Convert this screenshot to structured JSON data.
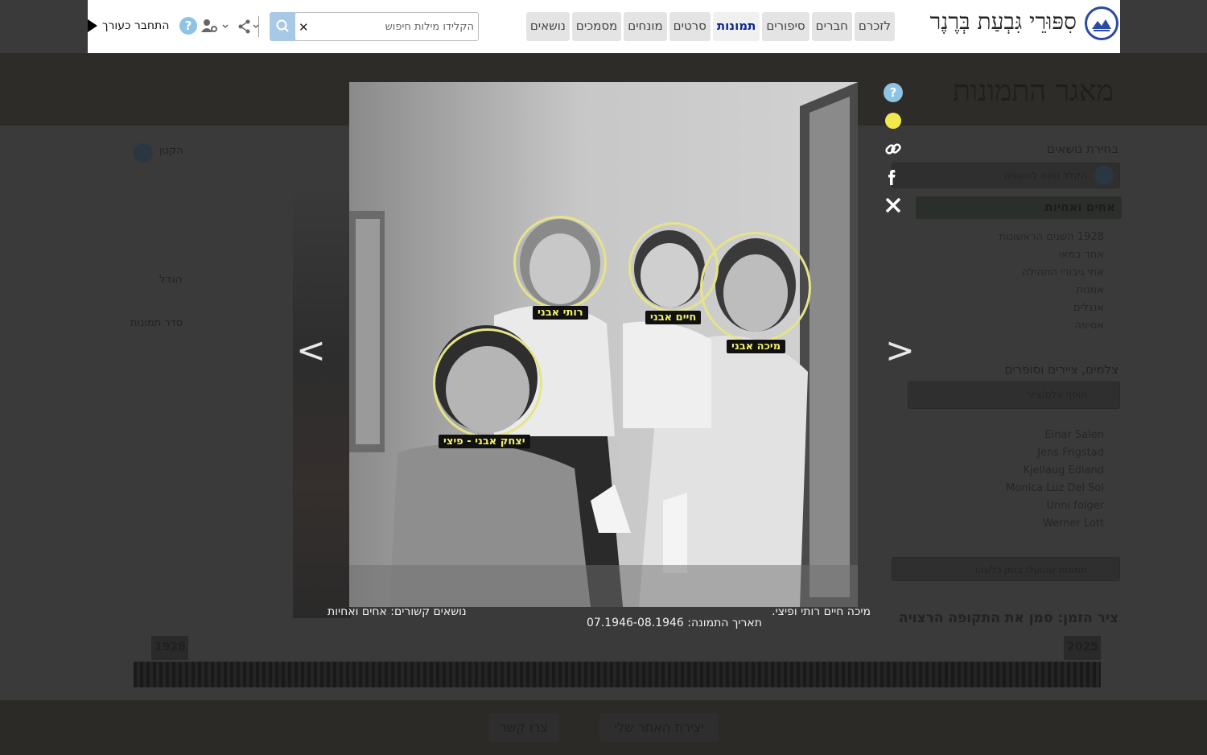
{
  "header": {
    "site_title": "סִפּוּרֵי גִּבְעַת בְּרֶנֶר",
    "nav": [
      {
        "label": "לזכרם",
        "active": false
      },
      {
        "label": "חברים",
        "active": false
      },
      {
        "label": "סיפורים",
        "active": false
      },
      {
        "label": "תמונות",
        "active": true
      },
      {
        "label": "סרטים",
        "active": false
      },
      {
        "label": "מונחים",
        "active": false
      },
      {
        "label": "מסמכים",
        "active": false
      },
      {
        "label": "נושאים",
        "active": false
      }
    ],
    "search_placeholder": "הקלידו מילות חיפוש",
    "clear_icon": "close-icon",
    "search_icon": "search-icon",
    "help_icon": "help-icon",
    "user_admin_icon": "user-gear-icon",
    "share_icon": "share-icon",
    "login_label": "התחבר כעורך",
    "colors": {
      "active_tab": "#0b2a8a",
      "search_button": "#a7c9e6",
      "logo": "#2c4aa0"
    }
  },
  "background_page": {
    "title": "מאגר התמונות",
    "topics_label": "בחירת נושאים",
    "topics_placeholder": "הקלד נושא להוספה",
    "selected_topic": "אחים ואחיות",
    "topics": [
      "1928 השנים הראשונות",
      "אחד במאי",
      "אחי גיבורי התהילה",
      "אמנות",
      "אנגלים",
      "אסיפה",
      "..."
    ],
    "photographers_label": "צלמים, ציירים וסופרים",
    "photographers_placeholder": "הוסף צלם/צייר",
    "photographers": [
      "Einar Salen",
      "Jens Frigstad",
      "Kjellaug Edland",
      "Monica Luz Del Sol",
      "Unni folger",
      "Werner Lott",
      "..."
    ],
    "uploaded_select": "תמונות שהועלו בזמן כלשהו",
    "timeline_label": "ציר הזמן: סמן את התקופה הרצויה",
    "year_start": "1928",
    "year_end": "2025",
    "zoom_out_label": "הקטן",
    "zoom_in_label": "הגדל",
    "photo_count_label": "סדר תמונות",
    "footer_contact": "צרו קשר",
    "footer_create": "יצירת האתר שלי"
  },
  "lightbox": {
    "tags": [
      {
        "name": "רותי אבני"
      },
      {
        "name": "חיים אבני"
      },
      {
        "name": "מיכה אבני"
      },
      {
        "name": "יצחק אבני - פיצי"
      }
    ],
    "prev_arrow": "<",
    "next_arrow": ">",
    "tools": [
      "help-icon",
      "tag-toggle-icon",
      "link-icon",
      "facebook-icon",
      "close-icon"
    ],
    "caption_description": "מיכה חיים רותי ופיצי.",
    "caption_topics": "נושאים קשורים: אחים ואחיות",
    "caption_date": "תאריך התמונה: 07.1946-08.1946",
    "colors": {
      "tag_ring": "#e6e38a",
      "tag_text": "#f3ef6f",
      "tag_toggle": "#f2e94e",
      "help": "#8ec3e6"
    }
  }
}
